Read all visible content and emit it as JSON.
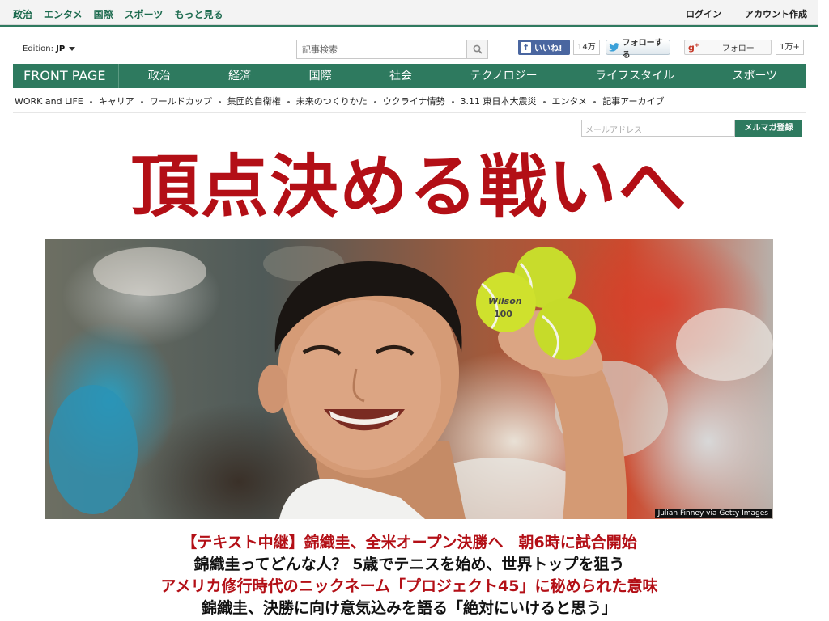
{
  "topbar": {
    "nav": [
      "政治",
      "エンタメ",
      "国際",
      "スポーツ",
      "もっと見る"
    ],
    "login": "ログイン",
    "create_account": "アカウント作成"
  },
  "edition": {
    "label": "Edition:",
    "value": "JP"
  },
  "search": {
    "placeholder": "記事検索"
  },
  "social": {
    "facebook_label": "いいね!",
    "facebook_count": "14万",
    "twitter_label": "フォローする",
    "gplus_label": "フォロー",
    "gplus_count": "1万+"
  },
  "main_nav": {
    "front_page": "FRONT PAGE",
    "items": [
      "政治",
      "経済",
      "国際",
      "社会",
      "テクノロジー",
      "ライフスタイル",
      "スポーツ"
    ]
  },
  "sub_nav": [
    "WORK and LIFE",
    "キャリア",
    "ワールドカップ",
    "集団的自衛権",
    "未来のつくりかた",
    "ウクライナ情勢",
    "3.11 東日本大震災",
    "エンタメ",
    "記事アーカイブ"
  ],
  "newsletter": {
    "placeholder": "メールアドレス",
    "button": "メルマガ登録"
  },
  "headline": "頂点決める戦いへ",
  "hero": {
    "credit": "Julian Finney via Getty Images",
    "ball_text": "Wilson 100"
  },
  "stories": [
    "【テキスト中継】錦織圭、全米オープン決勝へ　朝6時に試合開始",
    "錦織圭ってどんな人？ 5歳でテニスを始め、世界トップを狙う",
    "アメリカ修行時代のニックネーム「プロジェクト45」に秘められた意味",
    "錦織圭、決勝に向け意気込みを語る「絶対にいけると思う」"
  ],
  "colors": {
    "brand_green": "#2e7a5f",
    "headline_red": "#b30f16",
    "facebook_blue": "#4a66a0"
  },
  "icons": [
    "search-icon",
    "caret-down-icon",
    "facebook-icon",
    "twitter-bird-icon",
    "google-plus-icon"
  ]
}
